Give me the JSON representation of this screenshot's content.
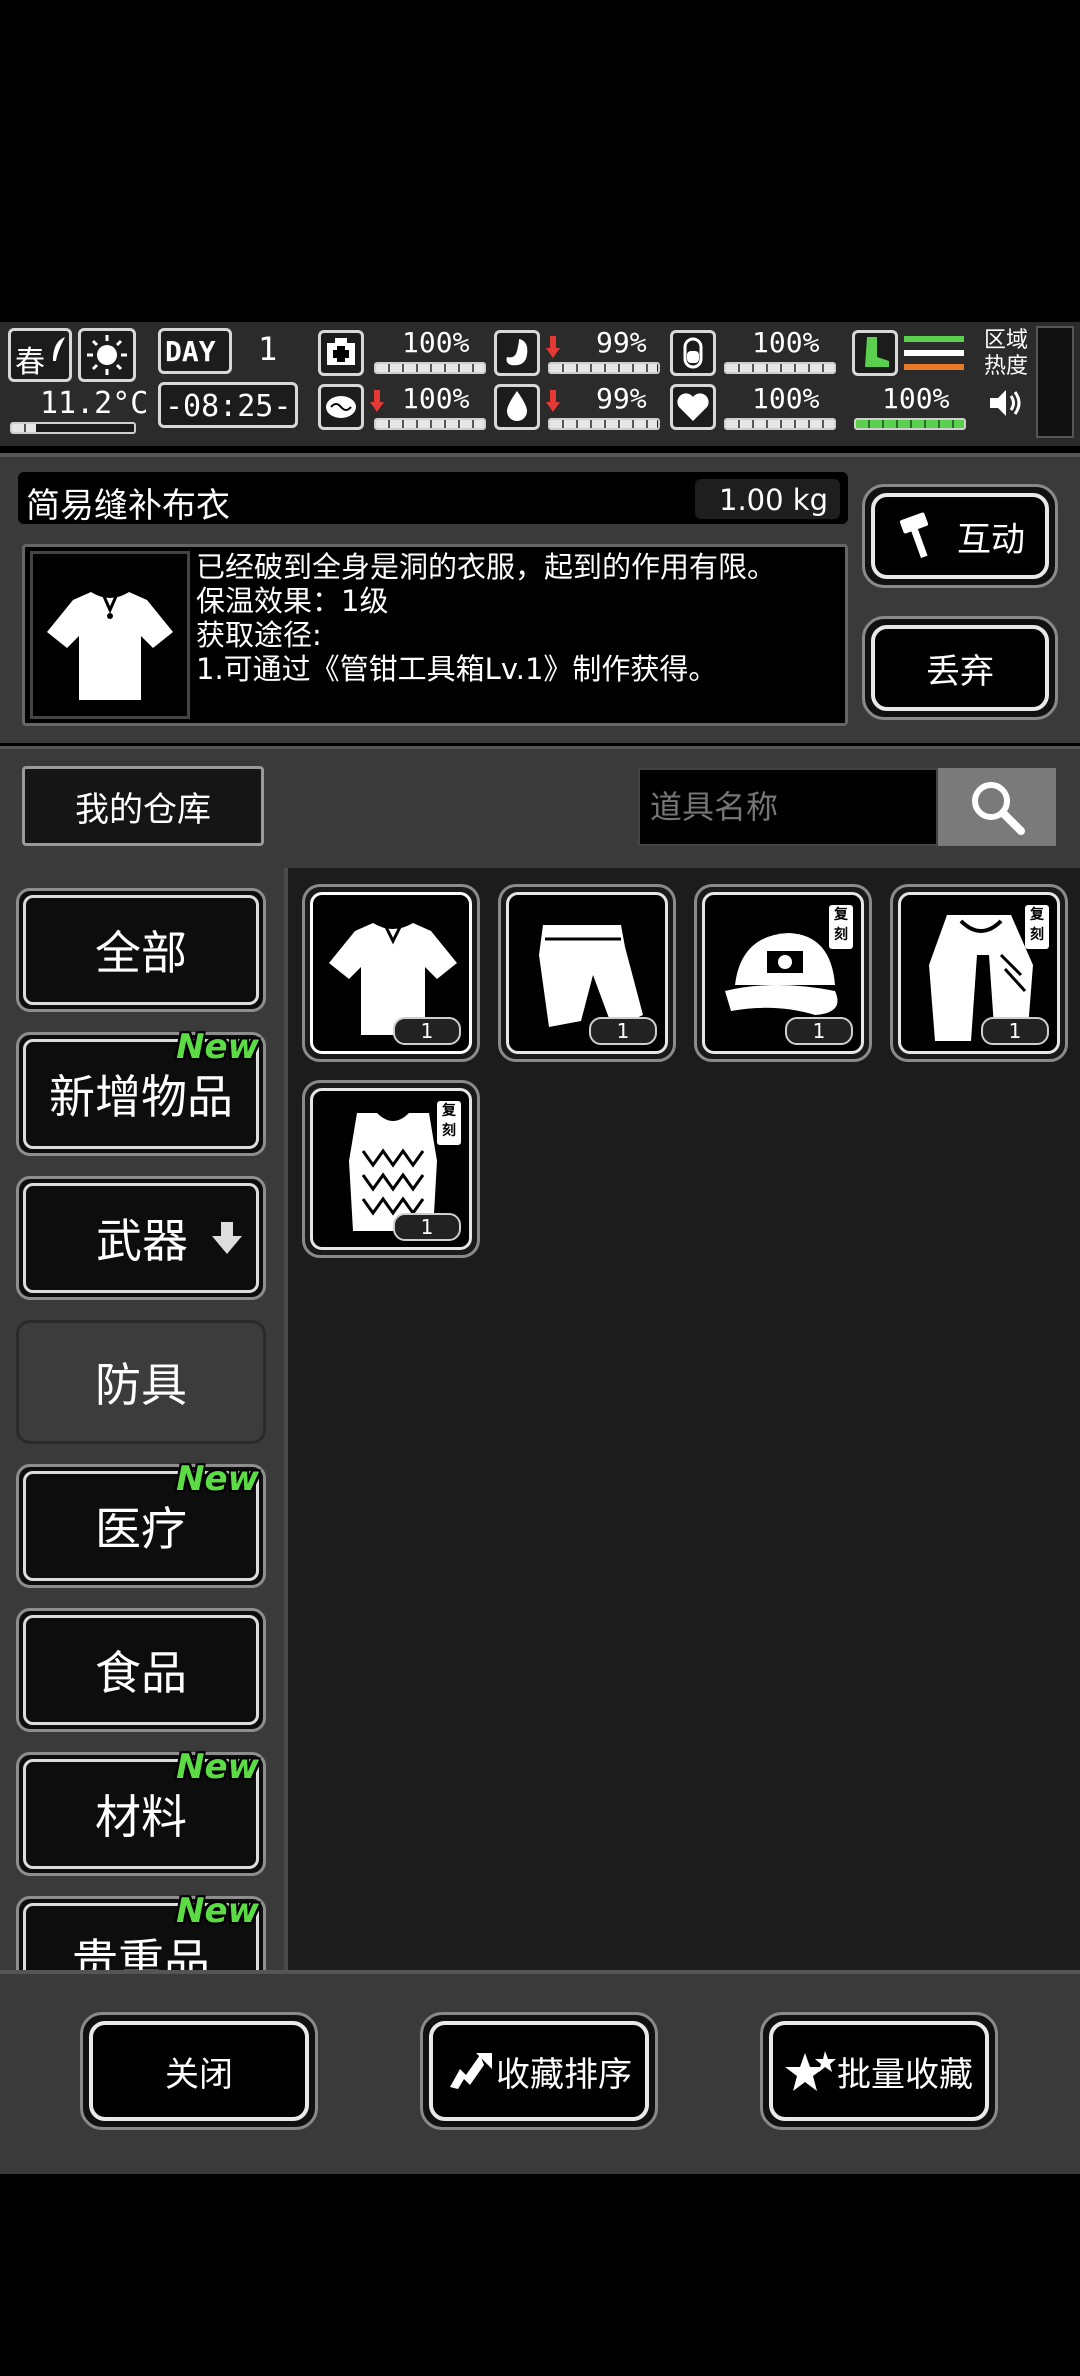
{
  "hud": {
    "season": "春",
    "temperature": "11.2°C",
    "day_label": "DAY",
    "day_value": "1",
    "time": "-08:25-",
    "stats": {
      "health": "100%",
      "stomach": "99%",
      "stamina": "100%",
      "brain": "100%",
      "water": "99%",
      "mood": "100%",
      "energy": "100%"
    },
    "levels": {
      "health": 1.0,
      "stomach": 0.99,
      "stamina": 1.0,
      "brain": 1.0,
      "water": 0.99,
      "mood": 1.0,
      "energy": 1.0
    },
    "zone_heat_label": "区域热度"
  },
  "detail": {
    "item_name": "简易缝补布衣",
    "weight": "1.00 kg",
    "desc_line1": "已经破到全身是洞的衣服，起到的作用有限。",
    "desc_line2": "保温效果：1级",
    "desc_line3": "获取途径:",
    "desc_line4": "1.可通过《管钳工具箱Lv.1》制作获得。",
    "interact_label": "互动",
    "discard_label": "丢弃"
  },
  "warehouse": {
    "title": "我的仓库",
    "search_placeholder": "道具名称"
  },
  "categories": [
    {
      "label": "全部",
      "is_new": false
    },
    {
      "label": "新增物品",
      "is_new": true
    },
    {
      "label": "武器",
      "is_new": false
    },
    {
      "label": "防具",
      "is_new": false
    },
    {
      "label": "医疗",
      "is_new": true
    },
    {
      "label": "食品",
      "is_new": false
    },
    {
      "label": "材料",
      "is_new": true
    },
    {
      "label": "贵重品",
      "is_new": true
    }
  ],
  "new_tag": "New",
  "items": [
    {
      "icon": "shirt-icon",
      "count": "1",
      "copy": false
    },
    {
      "icon": "pants-icon",
      "count": "1",
      "copy": false
    },
    {
      "icon": "cap-icon",
      "count": "1",
      "copy": true
    },
    {
      "icon": "cape-icon",
      "count": "1",
      "copy": true
    },
    {
      "icon": "vest-icon",
      "count": "1",
      "copy": true
    }
  ],
  "copy_badge": "复刻",
  "bottom": {
    "close_label": "关闭",
    "sort_label": "收藏排序",
    "batch_label": "批量收藏"
  },
  "colors": {
    "new_tag": "#5bdc45",
    "energy_bar": "#5ad04e",
    "decline_arrow": "#e53935"
  }
}
